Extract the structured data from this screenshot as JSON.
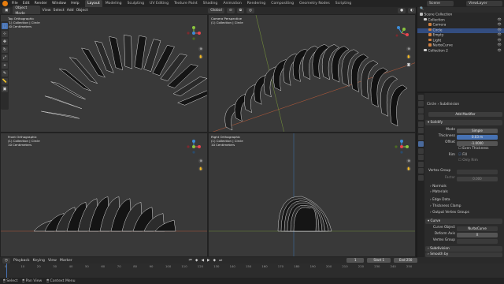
{
  "topbar": {
    "menus": [
      "File",
      "Edit",
      "Render",
      "Window",
      "Help"
    ],
    "workspaces": [
      "Layout",
      "Modeling",
      "Sculpting",
      "UV Editing",
      "Texture Paint",
      "Shading",
      "Animation",
      "Rendering",
      "Compositing",
      "Geometry Nodes",
      "Scripting"
    ],
    "scene": "Scene",
    "view_layer": "ViewLayer"
  },
  "viewport_header": {
    "mode": "Object Mode",
    "menus": [
      "View",
      "Select",
      "Add",
      "Object"
    ],
    "transform": "Global",
    "options": "Options"
  },
  "viewports": [
    {
      "view": "Top Orthographic",
      "collection": "(1) Collection | Circle",
      "scale": "10 Centimeters"
    },
    {
      "view": "Camera Perspective",
      "collection": "(1) Collection | Circle",
      "scale": ""
    },
    {
      "view": "Front Orthographic",
      "collection": "(1) Collection | Circle",
      "scale": "10 Centimeters"
    },
    {
      "view": "Right Orthographic",
      "collection": "(1) Collection | Circle",
      "scale": "10 Centimeters"
    }
  ],
  "outliner": {
    "root": "Scene Collection",
    "items": [
      {
        "label": "Collection",
        "color": "#d0d0d0",
        "selected": false
      },
      {
        "label": "Camera",
        "color": "#d08040",
        "selected": false
      },
      {
        "label": "Circle",
        "color": "#d08040",
        "selected": true
      },
      {
        "label": "Empty",
        "color": "#d08040",
        "selected": false
      },
      {
        "label": "Light",
        "color": "#d08040",
        "selected": false
      },
      {
        "label": "NurbsCurve",
        "color": "#d08040",
        "selected": false
      },
      {
        "label": "Collection 2",
        "color": "#d0d0d0",
        "selected": false
      }
    ]
  },
  "properties": {
    "breadcrumb_object": "Circle",
    "breadcrumb_mod": "Subdivision",
    "add_modifier": "Add Modifier",
    "solidify": {
      "name": "Solidify",
      "mode_label": "Mode",
      "mode": "Simple",
      "thickness_label": "Thickness",
      "thickness": "0.03 m",
      "offset_label": "Offset",
      "offset": "-1.0000",
      "even_thickness": "Even Thickness",
      "rim_label": "Rim",
      "fill": "Fill",
      "only_rim": "Only Rim",
      "vgroup_label": "Vertex Group",
      "factor_label": "Factor",
      "factor": "0.000"
    },
    "subpanels": [
      "Normals",
      "Materials",
      "Edge Data",
      "Thickness Clamp",
      "Output Vertex Groups"
    ],
    "curve": {
      "name": "Curve",
      "curve_object_label": "Curve Object",
      "curve_object": "NurbsCurve",
      "deform_axis_label": "Deform Axis",
      "deform_axis": "X",
      "vgroup_label": "Vertex Group"
    },
    "bottom_mods": [
      "Subdivision",
      "Smooth by"
    ]
  },
  "timeline": {
    "menus": [
      "Playback",
      "Keying",
      "View",
      "Marker"
    ],
    "current_frame": "1",
    "start_label": "Start",
    "start": "1",
    "end_label": "End",
    "end": "250",
    "ticks": [
      "0",
      "10",
      "20",
      "30",
      "40",
      "50",
      "60",
      "70",
      "80",
      "90",
      "100",
      "110",
      "120",
      "130",
      "140",
      "150",
      "160",
      "170",
      "180",
      "190",
      "200",
      "210",
      "220",
      "230",
      "240",
      "250"
    ]
  },
  "statusbar": {
    "items": [
      "Select",
      "Pan View",
      "Context Menu"
    ]
  },
  "colors": {
    "accent": "#4772b3",
    "active_object": "#e87d0d",
    "x_axis": "#e8454f",
    "y_axis": "#8bc53f",
    "z_axis": "#3c8bd6"
  }
}
